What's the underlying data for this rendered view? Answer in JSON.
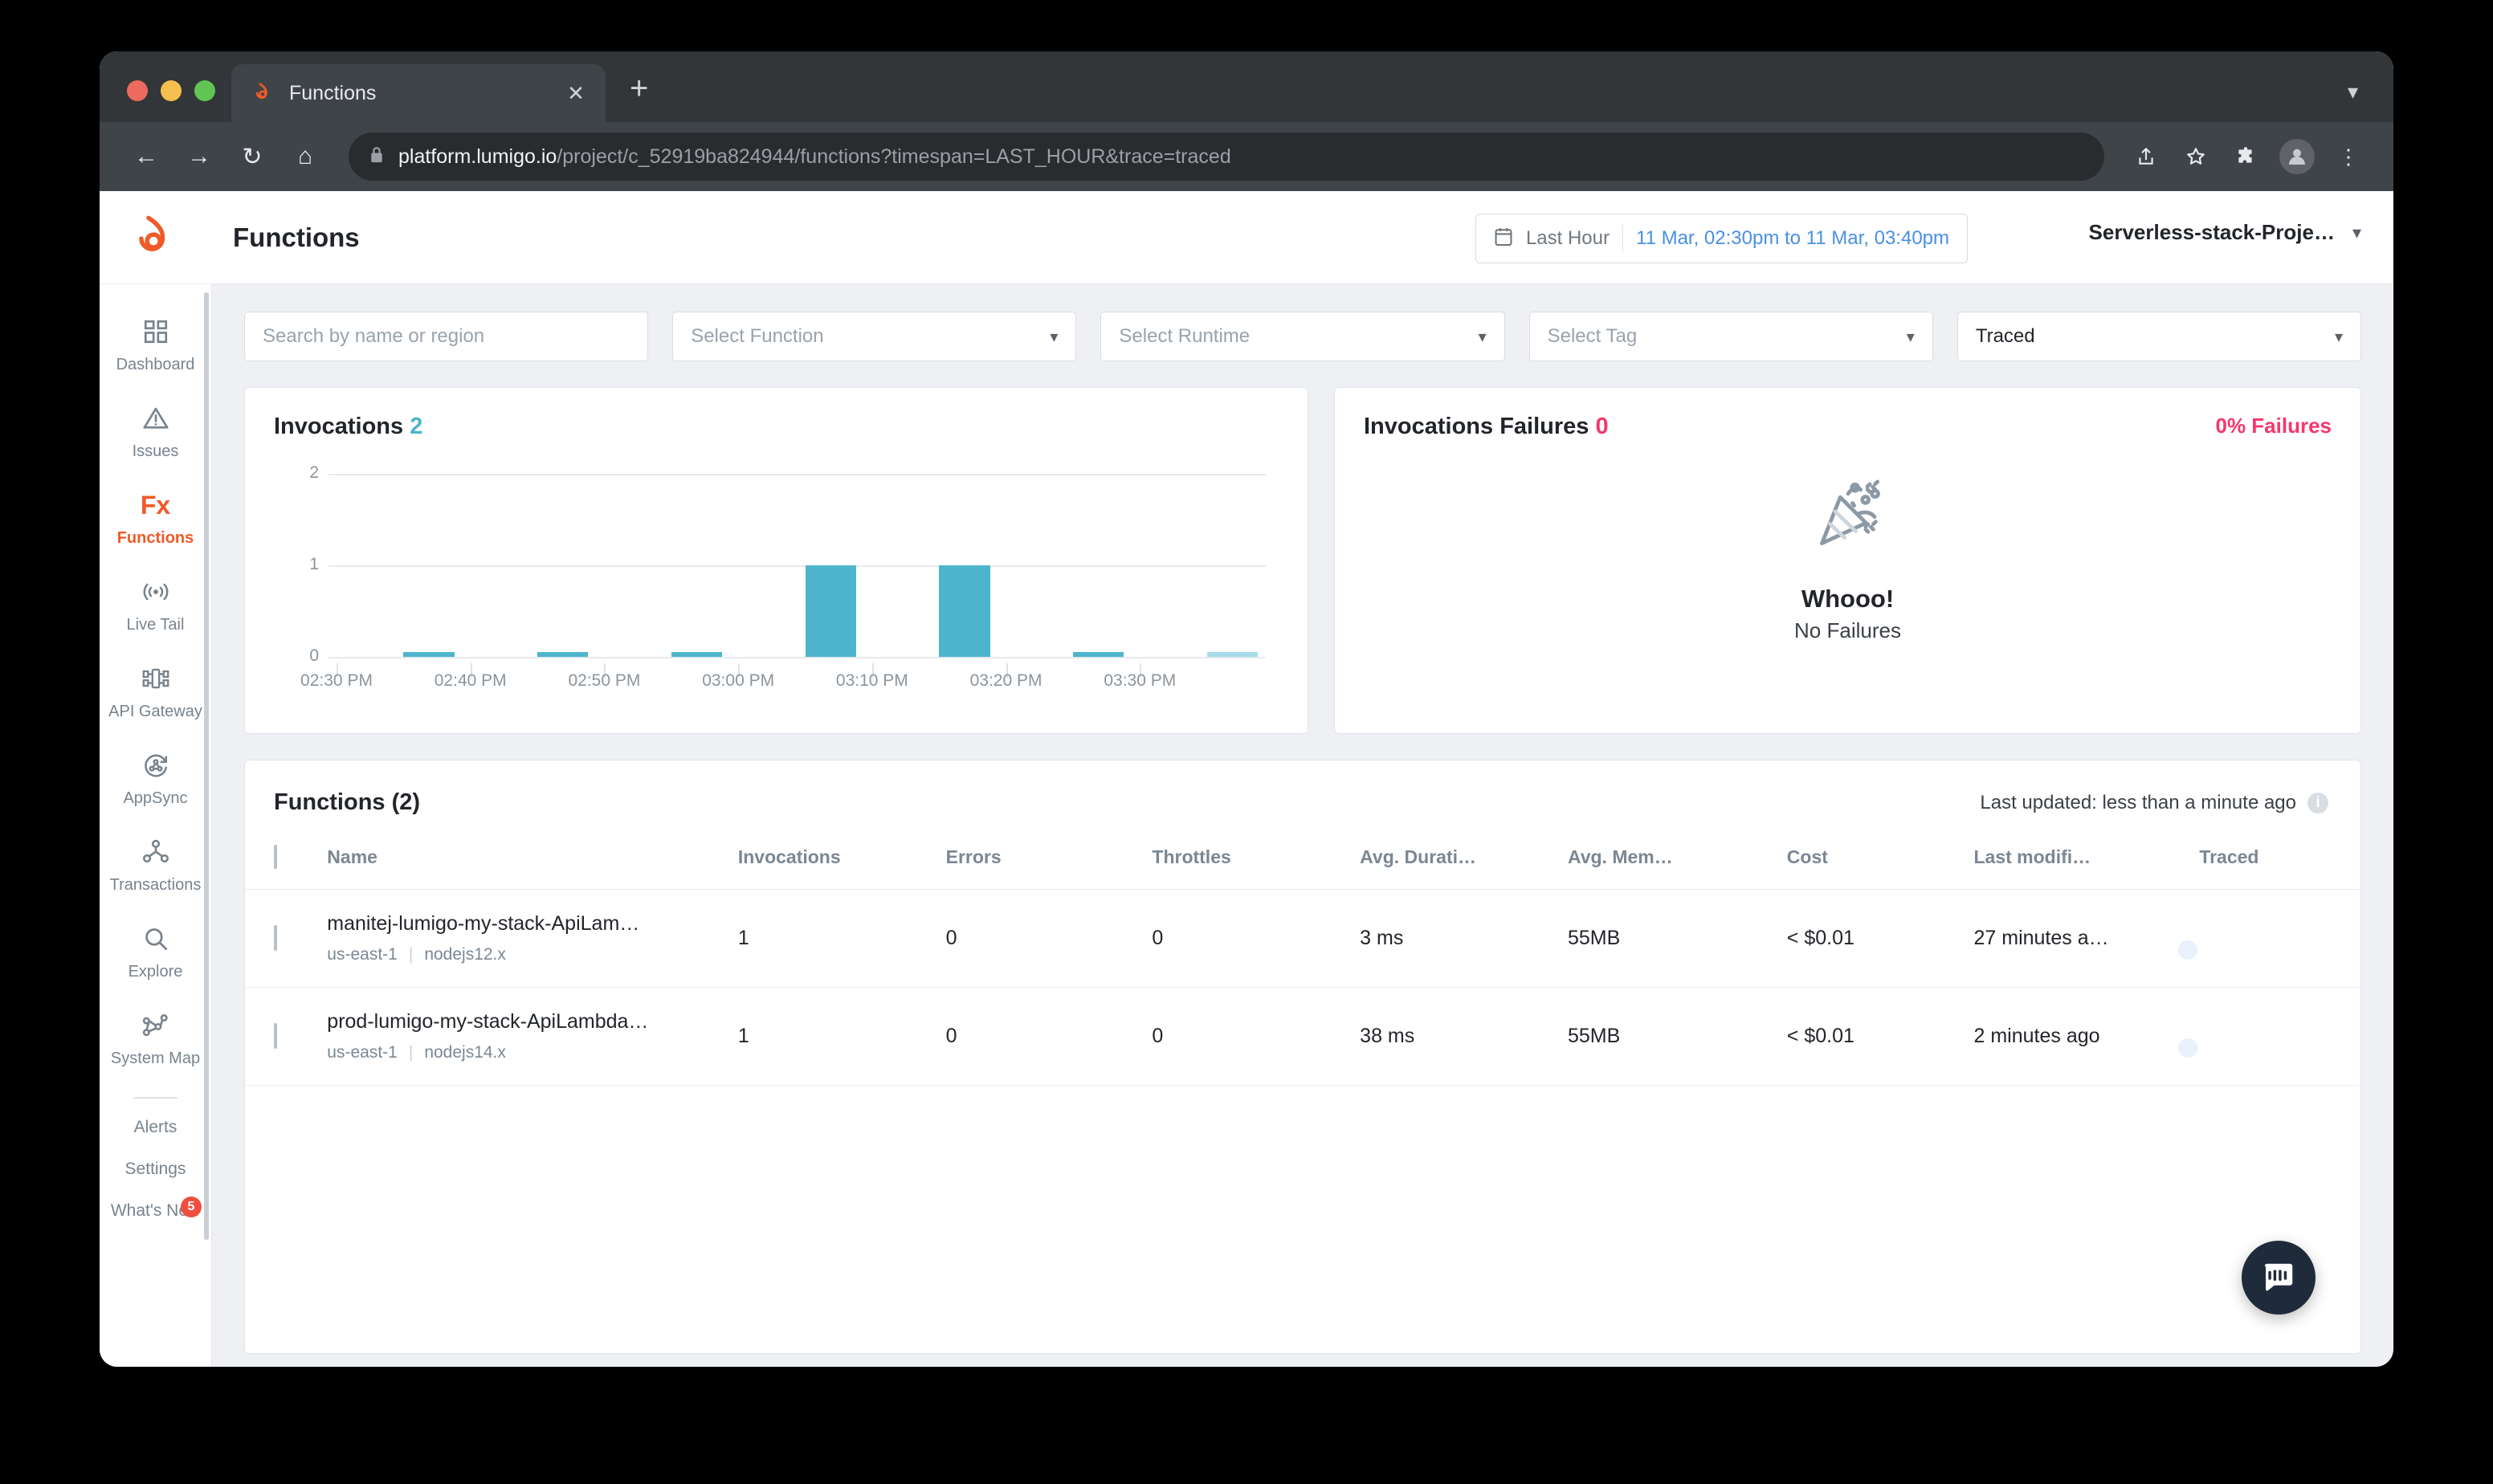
{
  "browser": {
    "tab": {
      "title": "Functions",
      "favicon_icon": "lumigo-flame-icon",
      "close_icon": "close-icon"
    },
    "new_tab_icon": "plus-icon",
    "tab_list_chevron_icon": "chevron-down-icon",
    "nav": {
      "back_icon": "arrow-left-icon",
      "forward_icon": "arrow-right-icon",
      "reload_icon": "reload-icon",
      "home_icon": "home-icon"
    },
    "omnibox": {
      "lock_icon": "lock-icon",
      "host": "platform.lumigo.io",
      "path": "/project/c_52919ba824944/functions?timespan=LAST_HOUR&trace=traced"
    },
    "toolbar_icons": [
      "share-icon",
      "star-icon",
      "extensions-icon",
      "profile-avatar",
      "menu-icon"
    ]
  },
  "header": {
    "logo_icon": "lumigo-flame-icon",
    "title": "Functions",
    "time_range": {
      "calendar_icon": "calendar-icon",
      "label": "Last Hour",
      "value": "11 Mar, 02:30pm to 11 Mar, 03:40pm"
    },
    "project": {
      "name": "Serverless-stack-Proje…",
      "chevron_icon": "chevron-down-icon"
    }
  },
  "sidebar": {
    "items": [
      {
        "label": "Dashboard",
        "icon": "dashboard-grid-icon",
        "active": false
      },
      {
        "label": "Issues",
        "icon": "warning-triangle-icon",
        "active": false
      },
      {
        "label": "Functions",
        "icon": "fx-icon",
        "active": true
      },
      {
        "label": "Live Tail",
        "icon": "broadcast-icon",
        "active": false
      },
      {
        "label": "API Gateway",
        "icon": "api-gateway-icon",
        "active": false
      },
      {
        "label": "AppSync",
        "icon": "appsync-icon",
        "active": false
      },
      {
        "label": "Transactions",
        "icon": "transactions-node-icon",
        "active": false
      },
      {
        "label": "Explore",
        "icon": "search-icon",
        "active": false
      },
      {
        "label": "System Map",
        "icon": "system-map-icon",
        "active": false
      }
    ],
    "text_items": [
      {
        "label": "Alerts",
        "badge": null
      },
      {
        "label": "Settings",
        "badge": null
      },
      {
        "label": "What's New",
        "badge": "5"
      }
    ]
  },
  "filters": [
    {
      "name": "search",
      "placeholder": "Search by name or region",
      "value": "",
      "has_chevron": false
    },
    {
      "name": "function",
      "placeholder": "Select Function",
      "value": "",
      "has_chevron": true
    },
    {
      "name": "runtime",
      "placeholder": "Select Runtime",
      "value": "",
      "has_chevron": true
    },
    {
      "name": "tag",
      "placeholder": "Select Tag",
      "value": "",
      "has_chevron": true
    },
    {
      "name": "traced",
      "placeholder": "",
      "value": "Traced",
      "has_chevron": true
    }
  ],
  "invocations_card": {
    "title": "Invocations",
    "count": "2"
  },
  "failures_card": {
    "title": "Invocations Failures",
    "count": "0",
    "percent_label": "0% Failures",
    "empty_icon": "party-popper-icon",
    "empty_title": "Whooo!",
    "empty_subtitle": "No Failures"
  },
  "functions_panel": {
    "title": "Functions (2)",
    "last_updated": "Last updated: less than a minute ago",
    "info_icon": "info-icon",
    "columns": [
      "",
      "Name",
      "Invocations",
      "Errors",
      "Throttles",
      "Avg. Durati…",
      "Avg. Mem…",
      "Cost",
      "Last modifi…",
      "Traced"
    ],
    "rows": [
      {
        "name": "manitej-lumigo-my-stack-ApiLam…",
        "region": "us-east-1",
        "runtime": "nodejs12.x",
        "invocations": "1",
        "errors": "0",
        "throttles": "0",
        "avg_duration": "3 ms",
        "avg_memory": "55MB",
        "cost": "< $0.01",
        "last_modified": "27 minutes a…",
        "traced": true
      },
      {
        "name": "prod-lumigo-my-stack-ApiLambda…",
        "region": "us-east-1",
        "runtime": "nodejs14.x",
        "invocations": "1",
        "errors": "0",
        "throttles": "0",
        "avg_duration": "38 ms",
        "avg_memory": "55MB",
        "cost": "< $0.01",
        "last_modified": "2 minutes ago",
        "traced": true
      }
    ]
  },
  "support_widget": {
    "icon": "intercom-chat-icon"
  },
  "colors": {
    "brand_orange": "#f05a28",
    "chart_blue": "#4db5cc",
    "chart_blue_faded": "#a9dceb",
    "failure_pink": "#f4376d",
    "link_blue": "#4a90e2",
    "toggle_on": "#bcd9f7"
  },
  "chart_data": {
    "type": "bar",
    "title": "Invocations",
    "xlabel": "",
    "ylabel": "",
    "ylim": [
      0,
      2
    ],
    "yticks": [
      "0",
      "1",
      "2"
    ],
    "grid": true,
    "legend": null,
    "xtick_labels": [
      "02:30 PM",
      "02:40 PM",
      "02:50 PM",
      "03:00 PM",
      "03:10 PM",
      "03:20 PM",
      "03:30 PM"
    ],
    "bar_color": "#4db5cc",
    "bar_color_partial": "#a9dceb",
    "bars": [
      {
        "x": "02:30 PM",
        "value": 0,
        "partial": false
      },
      {
        "x": "02:35 PM",
        "value": 0.03,
        "partial": false
      },
      {
        "x": "02:40 PM",
        "value": 0,
        "partial": false
      },
      {
        "x": "02:45 PM",
        "value": 0.03,
        "partial": false
      },
      {
        "x": "02:50 PM",
        "value": 0,
        "partial": false
      },
      {
        "x": "02:55 PM",
        "value": 0.03,
        "partial": false
      },
      {
        "x": "03:00 PM",
        "value": 0,
        "partial": false
      },
      {
        "x": "03:05 PM",
        "value": 1,
        "partial": false
      },
      {
        "x": "03:10 PM",
        "value": 0,
        "partial": false
      },
      {
        "x": "03:15 PM",
        "value": 1,
        "partial": false
      },
      {
        "x": "03:20 PM",
        "value": 0,
        "partial": false
      },
      {
        "x": "03:25 PM",
        "value": 0.03,
        "partial": false
      },
      {
        "x": "03:30 PM",
        "value": 0,
        "partial": false
      },
      {
        "x": "03:35 PM",
        "value": 0.03,
        "partial": true
      }
    ]
  }
}
